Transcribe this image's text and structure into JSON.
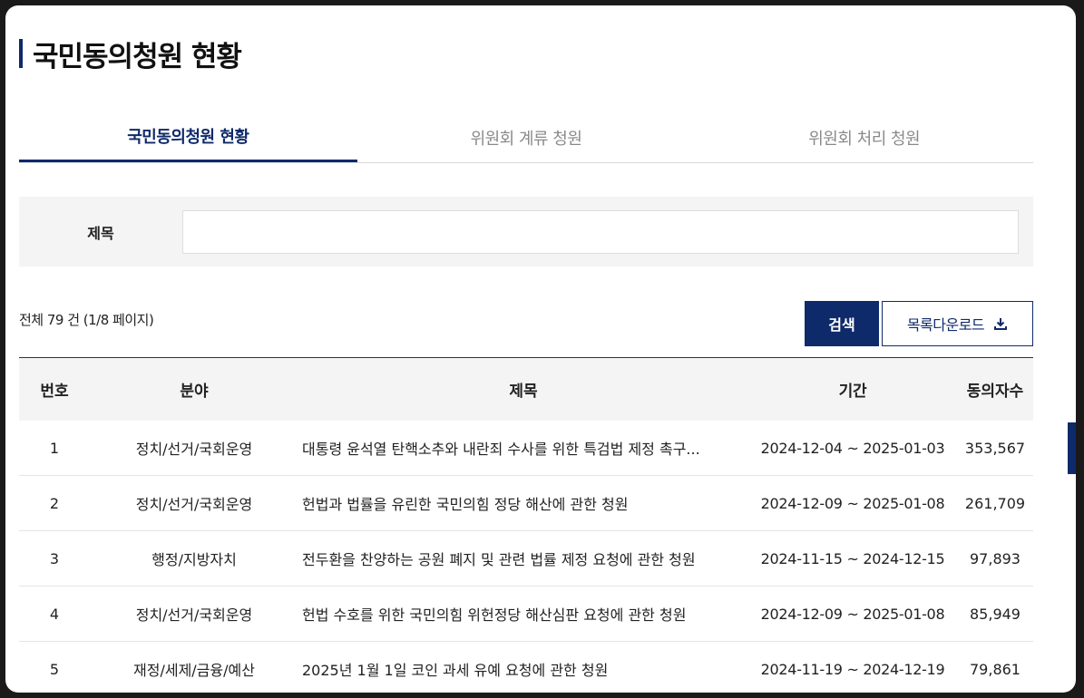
{
  "page": {
    "title": "국민동의청원 현황"
  },
  "tabs": [
    {
      "label": "국민동의청원 현황",
      "active": true
    },
    {
      "label": "위원회 계류 청원",
      "active": false
    },
    {
      "label": "위원회 처리 청원",
      "active": false
    }
  ],
  "search": {
    "label": "제목",
    "value": "",
    "placeholder": ""
  },
  "summary": {
    "total_text": "전체 79 건 (1/8 페이지)"
  },
  "buttons": {
    "search": "검색",
    "download": "목록다운로드"
  },
  "table": {
    "headers": {
      "no": "번호",
      "field": "분야",
      "title": "제목",
      "period": "기간",
      "count": "동의자수"
    },
    "rows": [
      {
        "no": "1",
        "field": "정치/선거/국회운영",
        "title": "대통령 윤석열 탄핵소추와 내란죄 수사를 위한 특검법 제정 촉구...",
        "period": "2024-12-04 ~ 2025-01-03",
        "count": "353,567"
      },
      {
        "no": "2",
        "field": "정치/선거/국회운영",
        "title": "헌법과 법률을 유린한 국민의힘 정당 해산에 관한 청원",
        "period": "2024-12-09 ~ 2025-01-08",
        "count": "261,709"
      },
      {
        "no": "3",
        "field": "행정/지방자치",
        "title": "전두환을 찬양하는 공원 폐지 및 관련 법률 제정 요청에 관한 청원",
        "period": "2024-11-15 ~ 2024-12-15",
        "count": "97,893"
      },
      {
        "no": "4",
        "field": "정치/선거/국회운영",
        "title": "헌법 수호를 위한 국민의힘 위헌정당 해산심판 요청에 관한 청원",
        "period": "2024-12-09 ~ 2025-01-08",
        "count": "85,949"
      },
      {
        "no": "5",
        "field": "재정/세제/금융/예산",
        "title": "2025년 1월 1일 코인 과세 유예 요청에 관한 청원",
        "period": "2024-11-19 ~ 2024-12-19",
        "count": "79,861"
      }
    ]
  },
  "colors": {
    "accent": "#0f2a6b",
    "header_bg": "#f4f4f4"
  }
}
